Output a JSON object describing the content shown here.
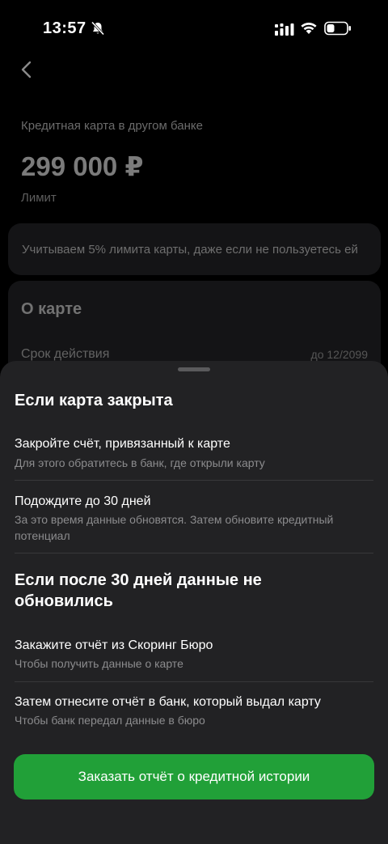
{
  "status_bar": {
    "time": "13:57"
  },
  "background": {
    "card_caption": "Кредитная карта в другом банке",
    "limit_value": "299 000 ₽",
    "limit_label": "Лимит",
    "info_text": "Учитываем 5% лимита карты, даже если не пользуетесь ей",
    "about": {
      "title": "О карте",
      "validity_label": "Срок действия",
      "validity_value": "до 12/2099"
    }
  },
  "sheet": {
    "section1_title": "Если карта закрыта",
    "items1": [
      {
        "title": "Закройте счёт, привязанный к карте",
        "subtitle": "Для этого обратитесь в банк, где открыли карту"
      },
      {
        "title": "Подождите до 30 дней",
        "subtitle": "За это время данные обновятся. Затем обновите кредитный потенциал"
      }
    ],
    "section2_title": "Если после 30 дней данные не обновились",
    "items2": [
      {
        "title": "Закажите отчёт из Скоринг Бюро",
        "subtitle": "Чтобы получить данные о карте"
      },
      {
        "title": "Затем отнесите отчёт в банк, который выдал карту",
        "subtitle": "Чтобы банк передал данные в бюро"
      }
    ],
    "button_label": "Заказать отчёт о кредитной истории"
  },
  "colors": {
    "accent": "#21a038",
    "sheet_bg": "#222224",
    "background": "#000000"
  },
  "icons": [
    "bell-off-icon",
    "signal-icon",
    "wifi-icon",
    "battery-icon",
    "back-chevron-icon"
  ]
}
